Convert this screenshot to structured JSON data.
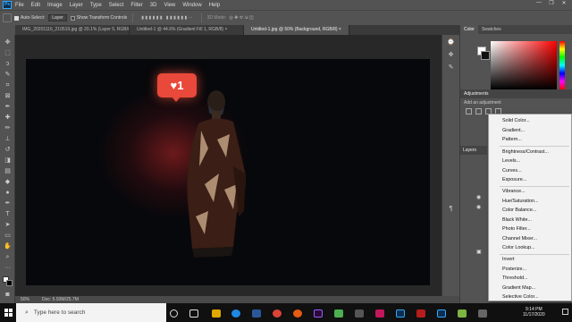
{
  "app": {
    "logo": "Ps"
  },
  "menubar": {
    "items": [
      "File",
      "Edit",
      "Image",
      "Layer",
      "Type",
      "Select",
      "Filter",
      "3D",
      "View",
      "Window",
      "Help"
    ]
  },
  "window_controls": {
    "minimize": "—",
    "maximize": "❐",
    "close": "✕"
  },
  "options_bar": {
    "auto_select_label": "Auto-Select:",
    "auto_select_target": "Layer",
    "transform_controls_label": "Show Transform Controls",
    "mode_3d_label": "3D Mode:"
  },
  "tabs": [
    {
      "label": "IMG_20201116_210519.jpg @ 20.1% (Layer 5, RGB/8) ×"
    },
    {
      "label": "Untitled-1 @ 44.6% (Gradient Fill 1, RGB/8) ×"
    },
    {
      "label": "Untitled-1.jpg @ 50% (Background, RGB/8) ×"
    }
  ],
  "canvas": {
    "like_count": "1"
  },
  "statusbar": {
    "zoom": "50%",
    "doc_size": "Doc: 5.93M/25.7M"
  },
  "panels": {
    "color_tabs": [
      "Color",
      "Swatches"
    ],
    "adjustments_title": "Adjustments",
    "adjustments_sub": "Add an adjustment",
    "layers_title": "Layers"
  },
  "adjustment_menu": {
    "groups": [
      [
        "Solid Color...",
        "Gradient...",
        "Pattern..."
      ],
      [
        "Brightness/Contrast...",
        "Levels...",
        "Curves...",
        "Exposure..."
      ],
      [
        "Vibrance...",
        "Hue/Saturation...",
        "Color Balance...",
        "Black  White...",
        "Photo Filter...",
        "Channel Mixer...",
        "Color Lookup..."
      ],
      [
        "Invert",
        "Posterize...",
        "Threshold...",
        "Gradient Map...",
        "Selective Color..."
      ]
    ]
  },
  "taskbar": {
    "search_placeholder": "Type here to search",
    "clock_time": "9:14 PM",
    "clock_date": "11/17/2020"
  },
  "colors": {
    "accent": "#31a8ff",
    "like_bubble": "#e8493a"
  }
}
